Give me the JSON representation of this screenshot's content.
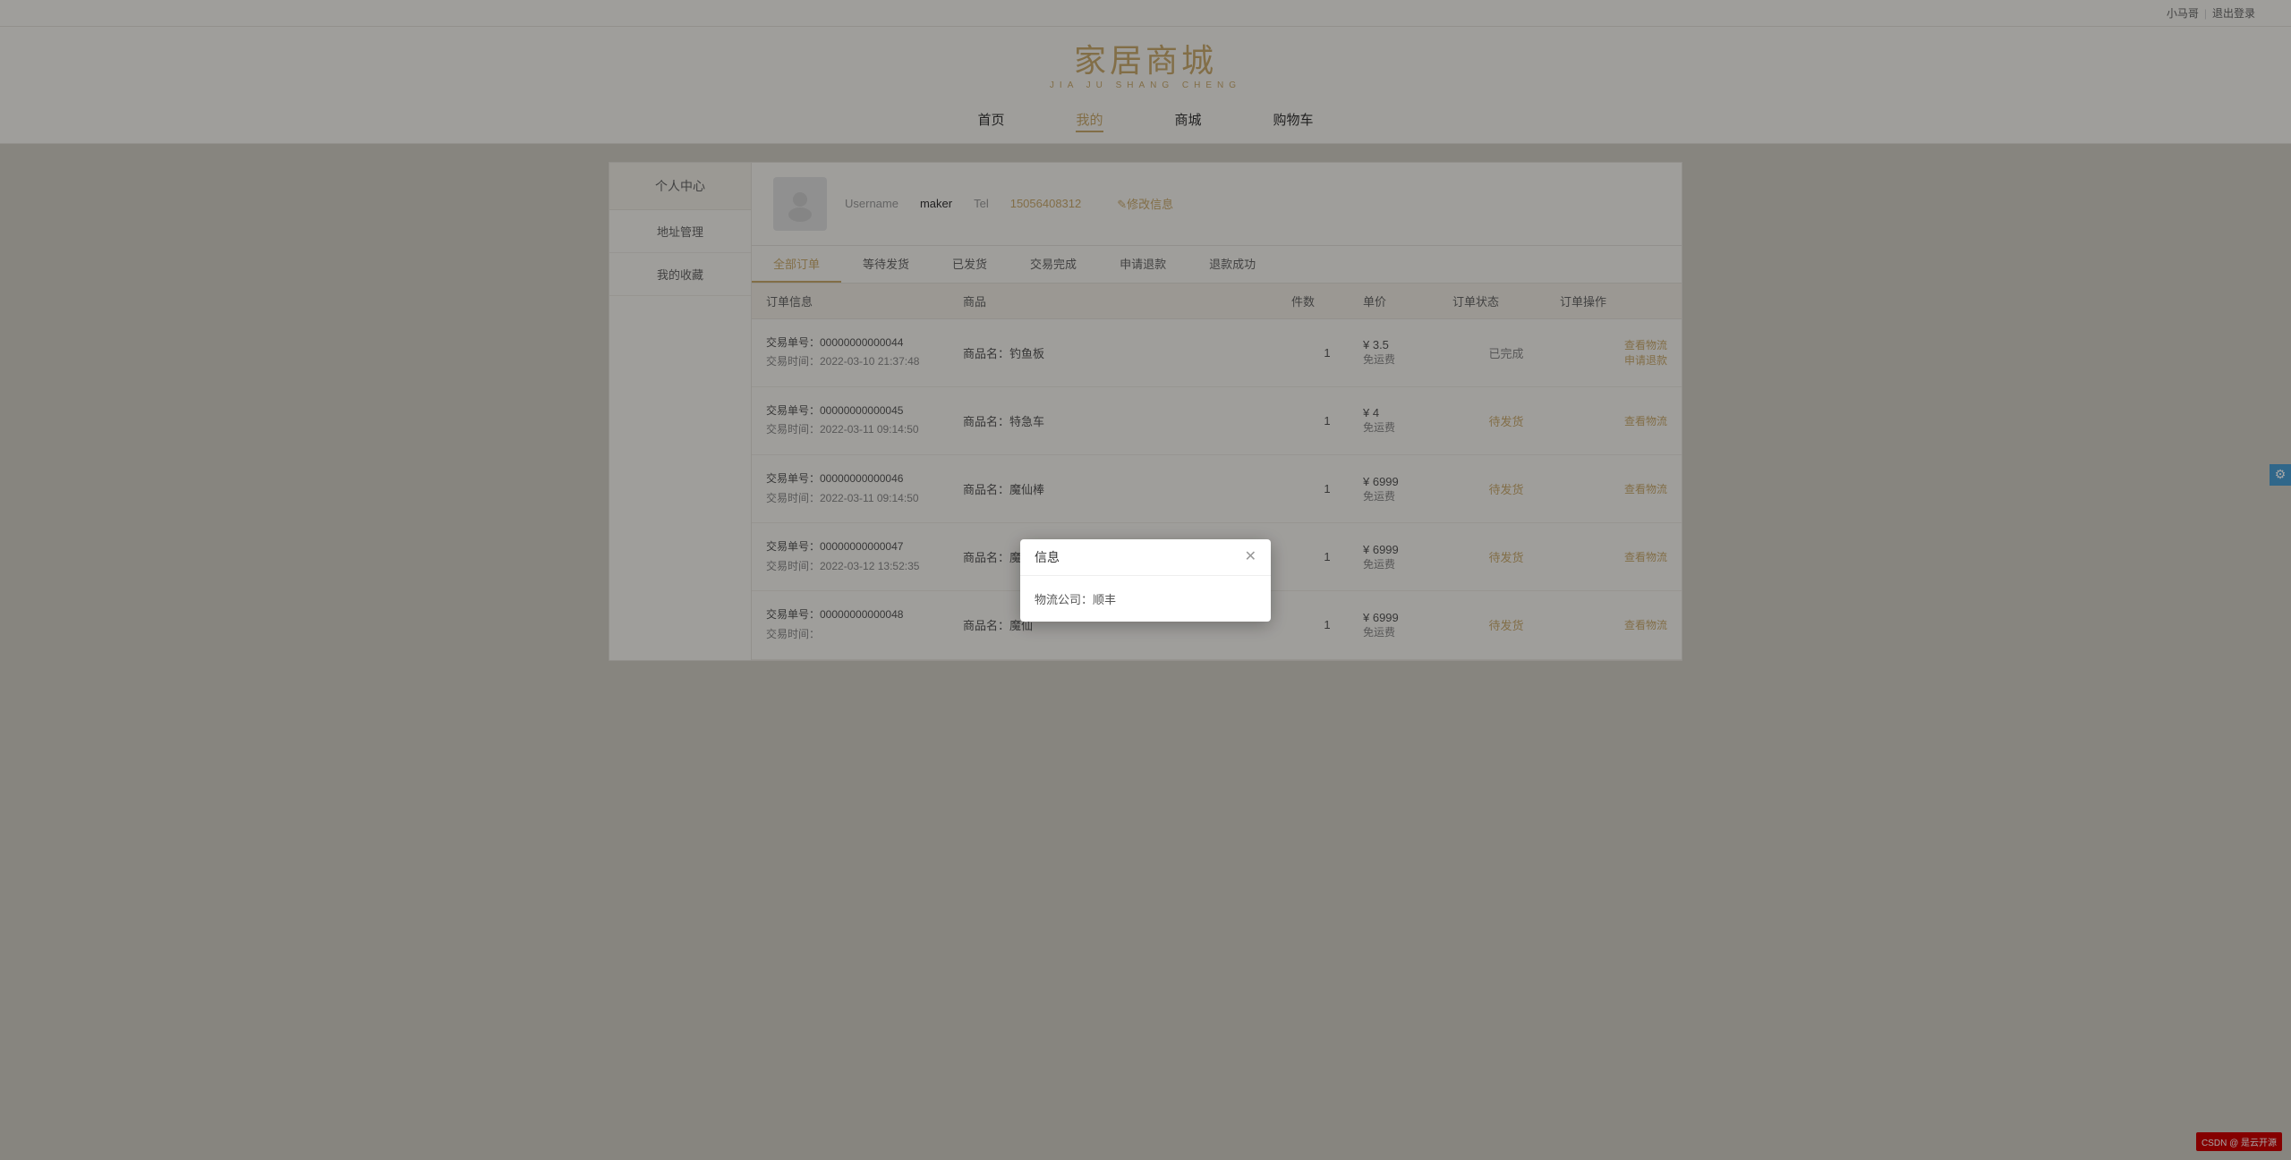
{
  "topbar": {
    "username": "小马哥",
    "divider": "|",
    "logout": "退出登录"
  },
  "logo": {
    "title": "家居商城",
    "subtitle": "JIA JU SHANG CHENG"
  },
  "nav": {
    "items": [
      {
        "label": "首页",
        "active": false
      },
      {
        "label": "我的",
        "active": true
      },
      {
        "label": "商城",
        "active": false
      },
      {
        "label": "购物车",
        "active": false
      }
    ]
  },
  "sidebar": {
    "header": "个人中心",
    "items": [
      {
        "label": "地址管理"
      },
      {
        "label": "我的收藏"
      }
    ]
  },
  "user_info": {
    "username_label": "Username",
    "username_value": "maker",
    "tel_label": "Tel",
    "tel_value": "15056408312",
    "edit_label": "✎修改信息"
  },
  "order_tabs": [
    {
      "label": "全部订单",
      "active": true
    },
    {
      "label": "等待发货",
      "active": false
    },
    {
      "label": "已发货",
      "active": false
    },
    {
      "label": "交易完成",
      "active": false
    },
    {
      "label": "申请退款",
      "active": false
    },
    {
      "label": "退款成功",
      "active": false
    }
  ],
  "table_headers": {
    "order_info": "订单信息",
    "product": "商品",
    "qty": "件数",
    "unit_price": "单价",
    "status": "订单状态",
    "action": "订单操作"
  },
  "orders": [
    {
      "tx_no_label": "交易单号：",
      "tx_no": "00000000000044",
      "tx_time_label": "交易时间：",
      "tx_time": "2022-03-10 21:37:48",
      "product": "商品名：钓鱼板",
      "qty": "1",
      "price": "¥ 3.5",
      "free_ship": "免运费",
      "status": "已完成",
      "status_type": "completed",
      "actions": [
        "查看物流",
        "申请退款"
      ]
    },
    {
      "tx_no_label": "交易单号：",
      "tx_no": "00000000000045",
      "tx_time_label": "交易时间：",
      "tx_time": "2022-03-11 09:14:50",
      "product": "商品名：特急车",
      "qty": "1",
      "price": "¥ 4",
      "free_ship": "免运费",
      "status": "待发货",
      "status_type": "pending",
      "actions": [
        "查看物流"
      ]
    },
    {
      "tx_no_label": "交易单号：",
      "tx_no": "00000000000046",
      "tx_time_label": "交易时间：",
      "tx_time": "2022-03-11 09:14:50",
      "product": "商品名：魔仙棒",
      "qty": "1",
      "price": "¥ 6999",
      "free_ship": "免运费",
      "status": "待发货",
      "status_type": "pending",
      "actions": [
        "查看物流"
      ]
    },
    {
      "tx_no_label": "交易单号：",
      "tx_no": "00000000000047",
      "tx_time_label": "交易时间：",
      "tx_time": "2022-03-12 13:52:35",
      "product": "商品名：魔仙棒",
      "qty": "1",
      "price": "¥ 6999",
      "free_ship": "免运费",
      "status": "待发货",
      "status_type": "pending",
      "actions": [
        "查看物流"
      ]
    },
    {
      "tx_no_label": "交易单号：",
      "tx_no": "00000000000048",
      "tx_time_label": "交易时间：",
      "tx_time": "",
      "product": "商品名：魔仙",
      "qty": "1",
      "price": "¥ 6999",
      "free_ship": "免运费",
      "status": "待发货",
      "status_type": "pending",
      "actions": [
        "查看物流"
      ]
    }
  ],
  "modal": {
    "title": "信息",
    "content": "物流公司：顺丰",
    "visible": true
  },
  "csdn": {
    "label": "CSDN @ 是云开源"
  }
}
